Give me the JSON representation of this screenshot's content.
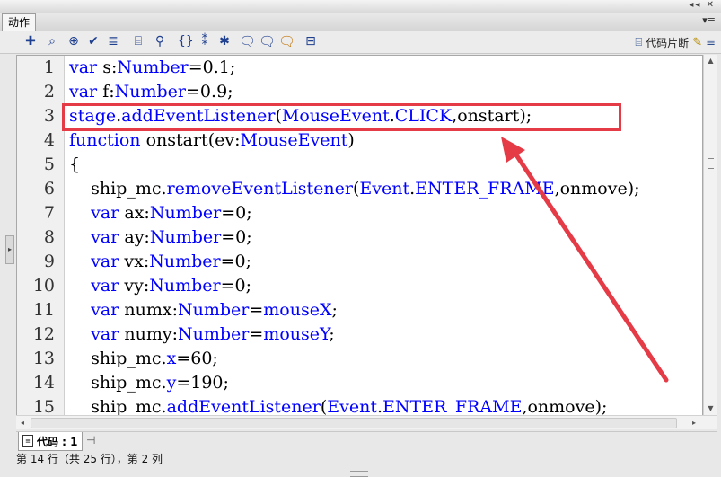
{
  "panel": {
    "tab_label": "动作",
    "menu_icon": "panel-menu-icon"
  },
  "toolbar": {
    "icons": [
      "add-script-item-icon",
      "find-icon",
      "target-path-icon",
      "check-syntax-icon",
      "auto-format-icon",
      "code-hint-icon",
      "debug-options-icon",
      "collapse-braces-icon",
      "collapse-selection-icon",
      "expand-all-icon",
      "apply-block-comment-icon",
      "apply-line-comment-icon",
      "remove-comment-icon",
      "toggle-toolbox-icon"
    ],
    "snippets_label": "代码片断",
    "help_icon": "help-icon"
  },
  "editor": {
    "line_numbers": [
      "1",
      "2",
      "3",
      "4",
      "5",
      "6",
      "7",
      "8",
      "9",
      "10",
      "11",
      "12",
      "13",
      "14",
      "15"
    ],
    "lines": [
      [
        {
          "t": "var",
          "c": "kw"
        },
        {
          "t": " s:"
        },
        {
          "t": "Number",
          "c": "ty"
        },
        {
          "t": "=0.1;"
        }
      ],
      [
        {
          "t": "var",
          "c": "kw"
        },
        {
          "t": " f:"
        },
        {
          "t": "Number",
          "c": "ty"
        },
        {
          "t": "=0.9;"
        }
      ],
      [
        {
          "t": "stage",
          "c": "kw"
        },
        {
          "t": "."
        },
        {
          "t": "addEventListener",
          "c": "kw"
        },
        {
          "t": "("
        },
        {
          "t": "MouseEvent",
          "c": "ty"
        },
        {
          "t": "."
        },
        {
          "t": "CLICK",
          "c": "kw"
        },
        {
          "t": ",onstart);"
        }
      ],
      [
        {
          "t": "function",
          "c": "kw"
        },
        {
          "t": " onstart(ev:"
        },
        {
          "t": "MouseEvent",
          "c": "ty"
        },
        {
          "t": ")"
        }
      ],
      [
        {
          "t": "{"
        }
      ],
      [
        {
          "t": "    ship_mc."
        },
        {
          "t": "removeEventListener",
          "c": "kw"
        },
        {
          "t": "("
        },
        {
          "t": "Event",
          "c": "ty"
        },
        {
          "t": "."
        },
        {
          "t": "ENTER_FRAME",
          "c": "kw"
        },
        {
          "t": ",onmove);"
        }
      ],
      [
        {
          "t": "    "
        },
        {
          "t": "var",
          "c": "kw"
        },
        {
          "t": " ax:"
        },
        {
          "t": "Number",
          "c": "ty"
        },
        {
          "t": "=0;"
        }
      ],
      [
        {
          "t": "    "
        },
        {
          "t": "var",
          "c": "kw"
        },
        {
          "t": " ay:"
        },
        {
          "t": "Number",
          "c": "ty"
        },
        {
          "t": "=0;"
        }
      ],
      [
        {
          "t": "    "
        },
        {
          "t": "var",
          "c": "kw"
        },
        {
          "t": " vx:"
        },
        {
          "t": "Number",
          "c": "ty"
        },
        {
          "t": "=0;"
        }
      ],
      [
        {
          "t": "    "
        },
        {
          "t": "var",
          "c": "kw"
        },
        {
          "t": " vy:"
        },
        {
          "t": "Number",
          "c": "ty"
        },
        {
          "t": "=0;"
        }
      ],
      [
        {
          "t": "    "
        },
        {
          "t": "var",
          "c": "kw"
        },
        {
          "t": " numx:"
        },
        {
          "t": "Number",
          "c": "ty"
        },
        {
          "t": "="
        },
        {
          "t": "mouseX",
          "c": "kw"
        },
        {
          "t": ";"
        }
      ],
      [
        {
          "t": "    "
        },
        {
          "t": "var",
          "c": "kw"
        },
        {
          "t": " numy:"
        },
        {
          "t": "Number",
          "c": "ty"
        },
        {
          "t": "="
        },
        {
          "t": "mouseY",
          "c": "kw"
        },
        {
          "t": ";"
        }
      ],
      [
        {
          "t": "    ship_mc."
        },
        {
          "t": "x",
          "c": "kw"
        },
        {
          "t": "=60;"
        }
      ],
      [
        {
          "t": "    ship_mc."
        },
        {
          "t": "y",
          "c": "kw"
        },
        {
          "t": "=190;"
        }
      ],
      [
        {
          "t": "    ship_mc."
        },
        {
          "t": "addEventListener",
          "c": "kw"
        },
        {
          "t": "("
        },
        {
          "t": "Event",
          "c": "ty"
        },
        {
          "t": "."
        },
        {
          "t": "ENTER_FRAME",
          "c": "kw"
        },
        {
          "t": ",onmove);"
        }
      ]
    ],
    "highlighted_line": "3"
  },
  "bottom": {
    "code_tab_label": "代码 : 1",
    "pin_icon": "pin-icon"
  },
  "status": {
    "text": "第 14 行（共 25 行），第 2 列"
  },
  "annotation": {
    "color": "#e53b46"
  }
}
